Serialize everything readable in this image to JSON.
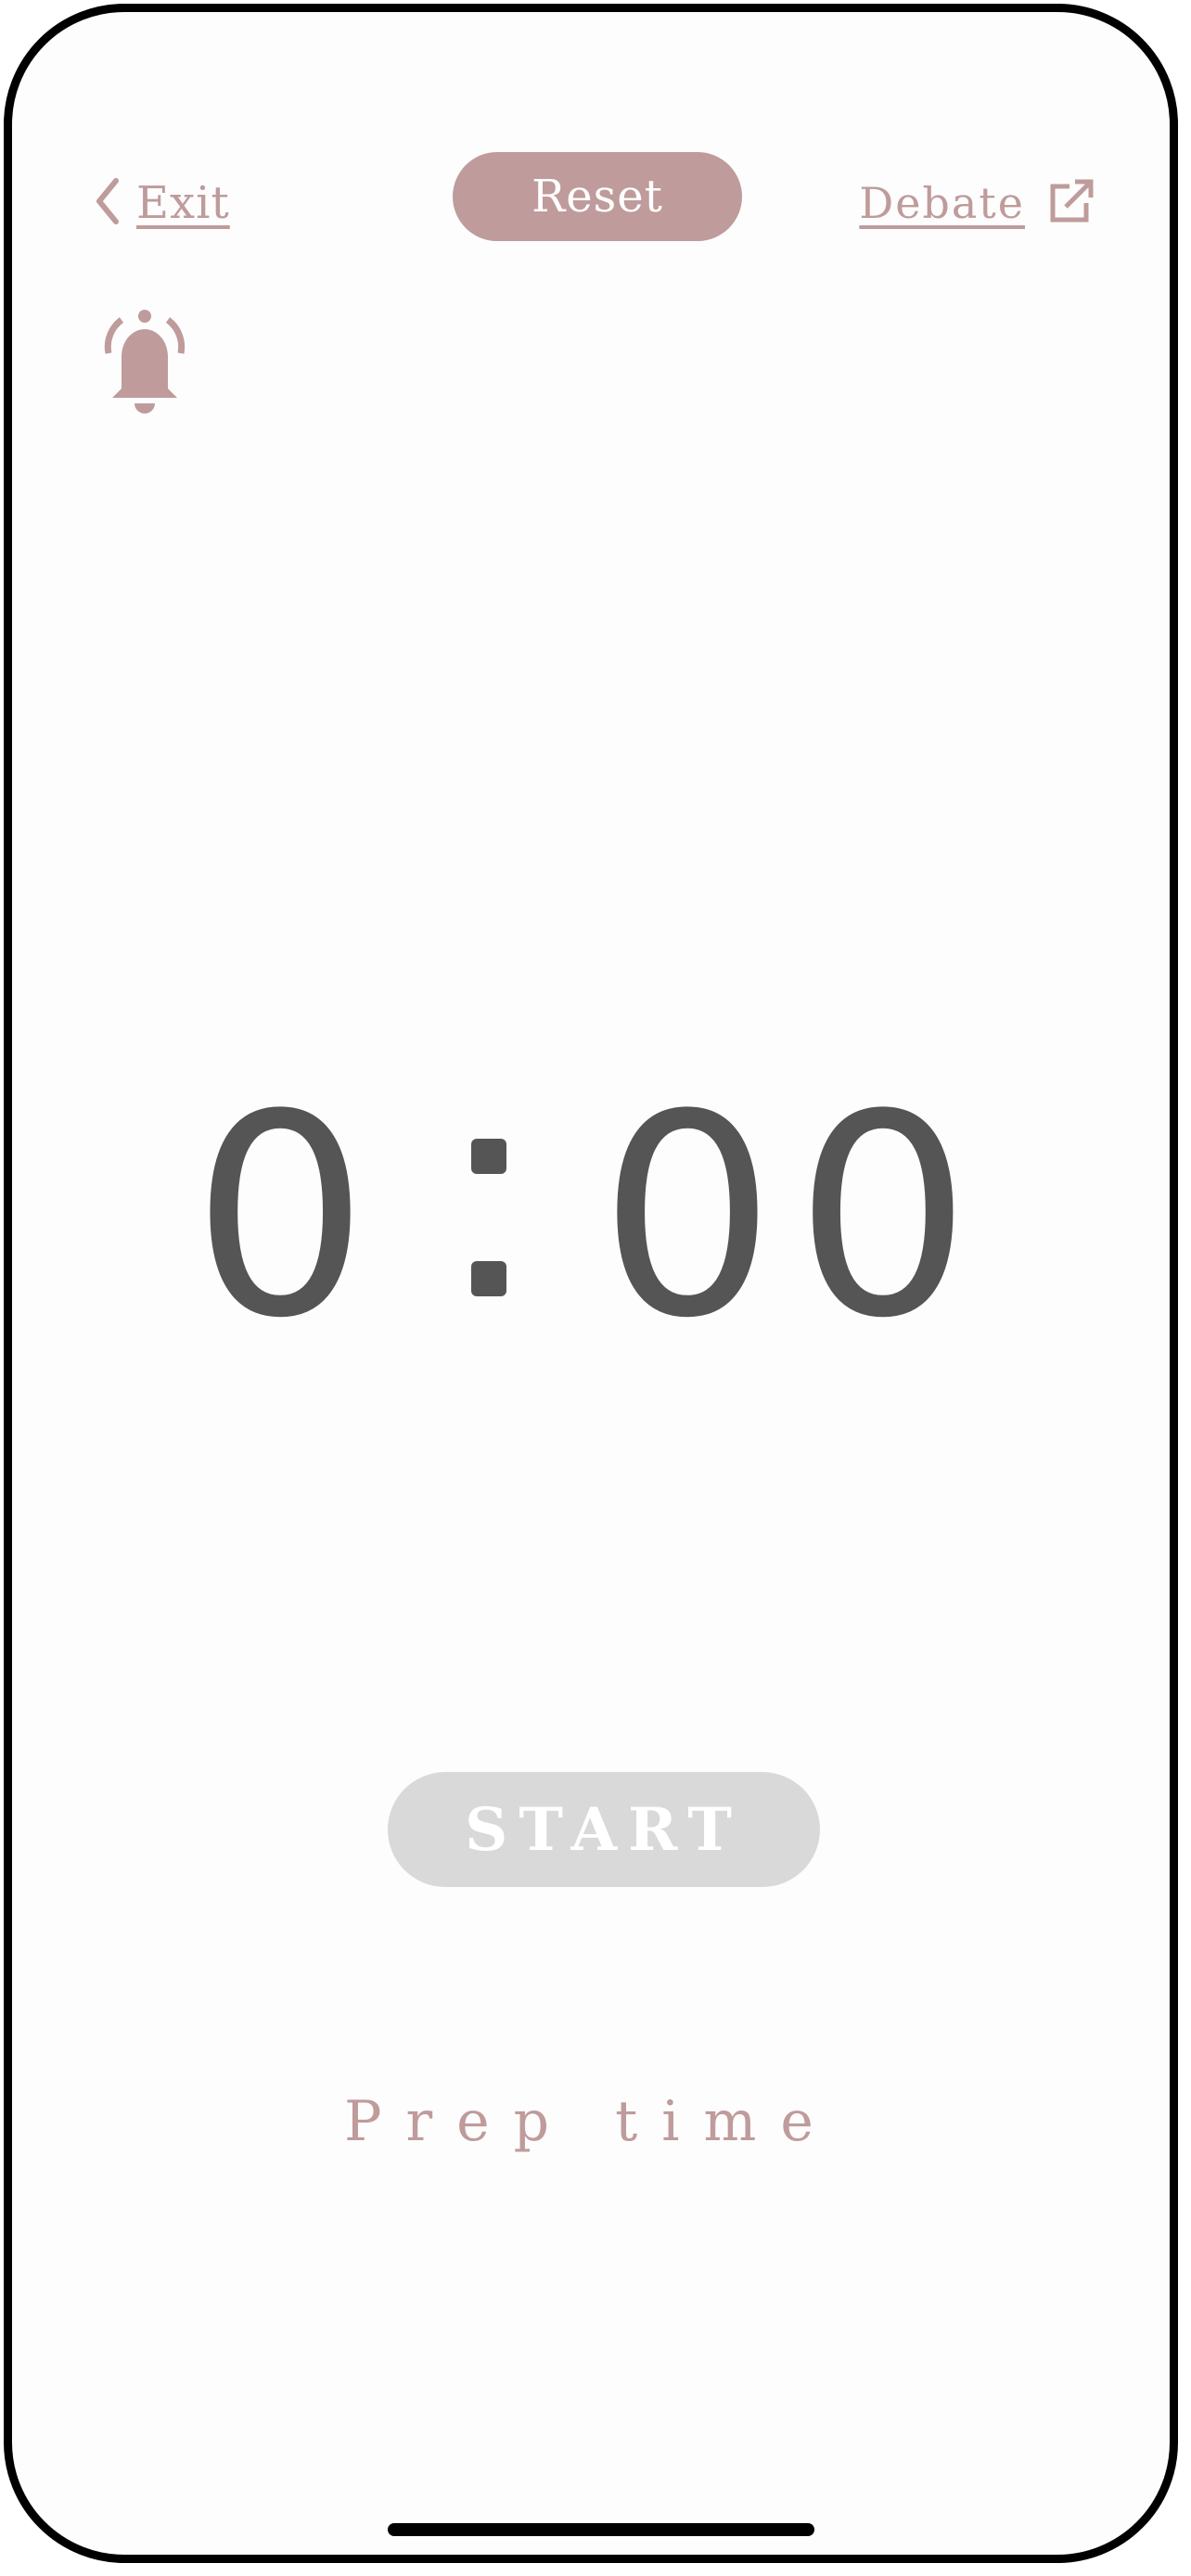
{
  "header": {
    "exit_label": "Exit",
    "reset_label": "Reset",
    "debate_label": "Debate"
  },
  "icons": {
    "back": "chevron-left-icon",
    "external": "external-link-icon",
    "alarm": "bell-icon"
  },
  "timer": {
    "minutes": "0",
    "seconds": "00"
  },
  "controls": {
    "start_label": "START"
  },
  "mode": {
    "label": "Prep time"
  },
  "colors": {
    "accent": "#bf9b9b",
    "timer_text": "#555555",
    "start_disabled": "#d9d9d9"
  }
}
